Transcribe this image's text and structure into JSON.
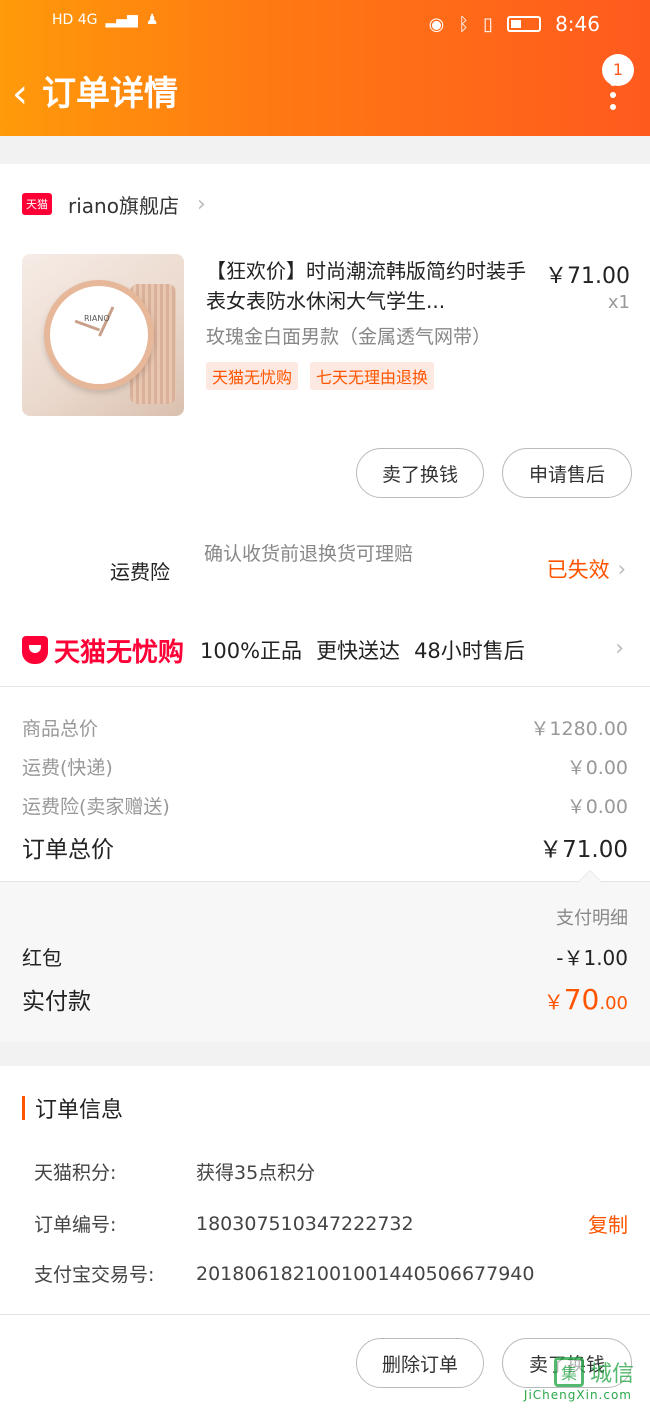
{
  "status_bar": {
    "left": "HD 4G",
    "time": "8:46"
  },
  "header": {
    "back": "‹",
    "title": "订单详情",
    "badge_count": "1"
  },
  "store": {
    "badge": "天猫",
    "name": "riano旗舰店"
  },
  "product": {
    "title": "【狂欢价】时尚潮流韩版简约时装手表女表防水休闲大气学生...",
    "price": "￥71.00",
    "qty": "x1",
    "sku": "玫瑰金白面男款（金属透气网带）",
    "tags": [
      "天猫无忧购",
      "七天无理由退换"
    ],
    "thumb_brand": "RIANO"
  },
  "item_buttons": {
    "sell": "卖了换钱",
    "aftersale": "申请售后"
  },
  "freight_insurance": {
    "label": "运费险",
    "desc": "确认收货前退换货可理赔",
    "status": "已失效"
  },
  "wuyou": {
    "brand": "天猫无忧购",
    "features": [
      "100%正品",
      "更快送达",
      "48小时售后"
    ]
  },
  "summary": [
    {
      "label": "商品总价",
      "value": "￥1280.00"
    },
    {
      "label": "运费(快递)",
      "value": "￥0.00"
    },
    {
      "label": "运费险(卖家赠送)",
      "value": "￥0.00"
    }
  ],
  "total": {
    "label": "订单总价",
    "value": "￥71.00"
  },
  "payment": {
    "detail_label": "支付明细",
    "redpacket_label": "红包",
    "redpacket_value": "-￥1.00",
    "paid_label": "实付款",
    "paid_symbol": "￥",
    "paid_int": "70",
    "paid_dec": ".00"
  },
  "order_info": {
    "heading": "订单信息",
    "points_label": "天猫积分:",
    "points_value": "获得35点积分",
    "order_no_label": "订单编号:",
    "order_no_value": "180307510347222732",
    "copy_label": "复制",
    "alipay_label": "支付宝交易号:",
    "alipay_value": "2018061821001001440506677940"
  },
  "footer_buttons": {
    "delete": "删除订单",
    "sell": "卖了换钱"
  },
  "watermark": {
    "logo": "集",
    "text": "城信",
    "url": "JiChengXin.com"
  }
}
